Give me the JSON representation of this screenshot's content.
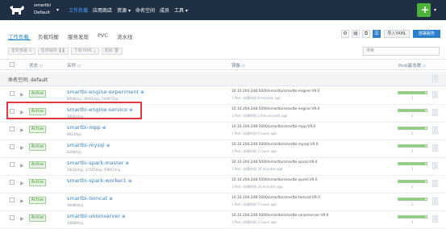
{
  "header": {
    "env_name": "smartbi",
    "env_sub": "Default",
    "nav": [
      "工作负载",
      "应用商店",
      "资源 ▾",
      "命名空间",
      "成员",
      "工具 ▾"
    ],
    "active_nav": 0
  },
  "tabs": [
    "工作负载",
    "负载均衡",
    "服务发现",
    "PVC",
    "流水线"
  ],
  "actions": {
    "import_yaml": "导入YAML",
    "deploy": "部署服务"
  },
  "toolbar": {
    "redeploy": "重新部署 ↻",
    "pause": "暂停编排 ❚❚",
    "download_yaml": "下载YAML ⤓",
    "delete": "删除 🗑"
  },
  "search": {
    "placeholder": "搜索"
  },
  "table": {
    "col_status": "状态 ◇",
    "col_name": "名称 ◇",
    "col_image": "镜像 ◇",
    "col_pods": "Pod/副本数 ◇"
  },
  "namespace_label": "命名空间: default",
  "rows": [
    {
      "status": "Active",
      "name": "smartbi-engine-experiment",
      "ports": "8009/tcp, 39001/tcp, 54967/tcp",
      "image": "10.10.204.248:5000/smartbi/smartbi-engine:V9.0",
      "meta": "1 Pod / 创建时间 8 minutes ago",
      "scale": "1",
      "fill": 0.95
    },
    {
      "status": "Active",
      "name": "smartbi-engine-service",
      "ports": "39002/tcp",
      "image": "10.10.204.248:5000/smartbi/smartbi-engine:V9.0",
      "meta": "1 Pod / 创建时间 a few seconds ago",
      "scale": "1",
      "fill": 0.95
    },
    {
      "status": "Active",
      "name": "smartbi-mpp",
      "ports": "9923/tcp",
      "image": "10.10.204.248:5000/smartbi/smartbi-mpp:V9.0",
      "meta": "1 Pod / 创建时间 6 hours ago",
      "scale": "1",
      "fill": 0.95
    },
    {
      "status": "Active",
      "name": "smartbi-mysql",
      "ports": "8306/tcp",
      "image": "10.10.204.248:5000/smartbi/smartbi-mysql:V9.0",
      "meta": "1 Pod / 创建时间 2 hours ago",
      "scale": "1",
      "fill": 0.95
    },
    {
      "status": "Active",
      "name": "smartbi-spark-master",
      "ports": "39022/tcp, 37355/tcp, 50967/tcp",
      "image": "10.10.204.248:5000/smartbi/smartbi-spark:V9.0",
      "meta": "1 Pod / 创建时间 26 minutes ago",
      "scale": "1",
      "fill": 0.95
    },
    {
      "status": "Active",
      "name": "smartbi-spark-worker1",
      "ports": "",
      "image": "10.10.204.248:5000/smartbi/smartbi-spark:V9.0",
      "meta": "1 Pod / 创建时间 24 minutes ago",
      "scale": "1",
      "fill": 0.95
    },
    {
      "status": "Active",
      "name": "smartbi-tomcat",
      "ports": "39080/tcp",
      "image": "10.10.204.248:5000/smartbi/smartbi-tomcat:V9.0",
      "meta": "1 Pod / 创建时间 5 hours ago",
      "scale": "1",
      "fill": 0.95
    },
    {
      "status": "Active",
      "name": "smartbi-unionserver",
      "ports": "30808/tcp",
      "image": "10.10.204.248:5000/smartbi/smartbi-unionserver:V9.0",
      "meta": "1 Pod / 创建时间 2 hours ago",
      "scale": "1",
      "fill": 0.95
    }
  ]
}
